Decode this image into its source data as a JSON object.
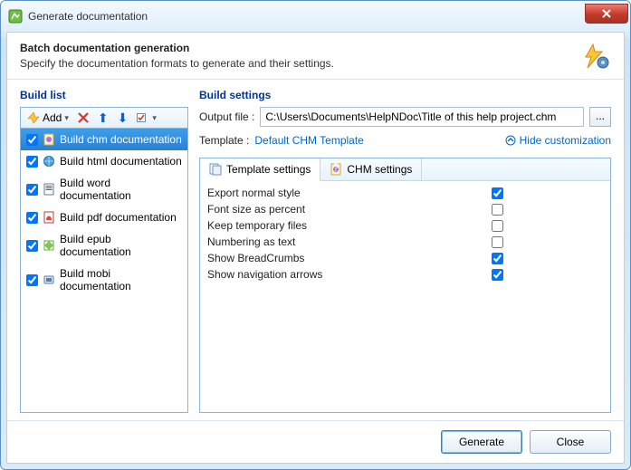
{
  "window": {
    "title": "Generate documentation"
  },
  "header": {
    "title": "Batch documentation generation",
    "subtitle": "Specify the documentation formats to generate and their settings."
  },
  "buildList": {
    "title": "Build list",
    "addLabel": "Add",
    "items": [
      {
        "label": "Build chm documentation",
        "checked": true
      },
      {
        "label": "Build html documentation",
        "checked": true
      },
      {
        "label": "Build word documentation",
        "checked": true
      },
      {
        "label": "Build pdf documentation",
        "checked": true
      },
      {
        "label": "Build epub documentation",
        "checked": true
      },
      {
        "label": "Build mobi documentation",
        "checked": true
      }
    ]
  },
  "buildSettings": {
    "title": "Build settings",
    "outputLabel": "Output file :",
    "outputValue": "C:\\Users\\Documents\\HelpNDoc\\Title of this help project.chm",
    "browse": "...",
    "templateLabel": "Template :",
    "templateLink": "Default CHM Template",
    "hideCustomization": "Hide customization",
    "tabs": [
      {
        "label": "Template settings"
      },
      {
        "label": "CHM settings"
      }
    ],
    "options": [
      {
        "label": "Export normal style",
        "checked": true
      },
      {
        "label": "Font size as percent",
        "checked": false
      },
      {
        "label": "Keep temporary files",
        "checked": false
      },
      {
        "label": "Numbering as text",
        "checked": false
      },
      {
        "label": "Show BreadCrumbs",
        "checked": true
      },
      {
        "label": "Show navigation arrows",
        "checked": true
      }
    ]
  },
  "footer": {
    "generate": "Generate",
    "close": "Close"
  }
}
